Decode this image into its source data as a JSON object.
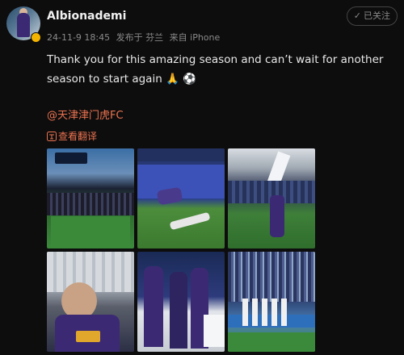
{
  "post": {
    "username": "Albionademi",
    "timestamp": "24-11-9 18:45",
    "published_from": "发布于 芬兰",
    "device": "来自 iPhone",
    "follow_status": "已关注",
    "text": "Thank you for this amazing season and can’t wait for another season to start again 🙏 ⚽",
    "mention": "@天津津门虎FC",
    "translate_label": "查看翻译"
  },
  "icons": {
    "avatar_badge": "verified-badge-icon",
    "follow": "check-icon",
    "translate": "translate-icon"
  },
  "colors": {
    "background": "#0d0d0d",
    "accent": "#eb7350",
    "muted": "#8a8a8a"
  }
}
